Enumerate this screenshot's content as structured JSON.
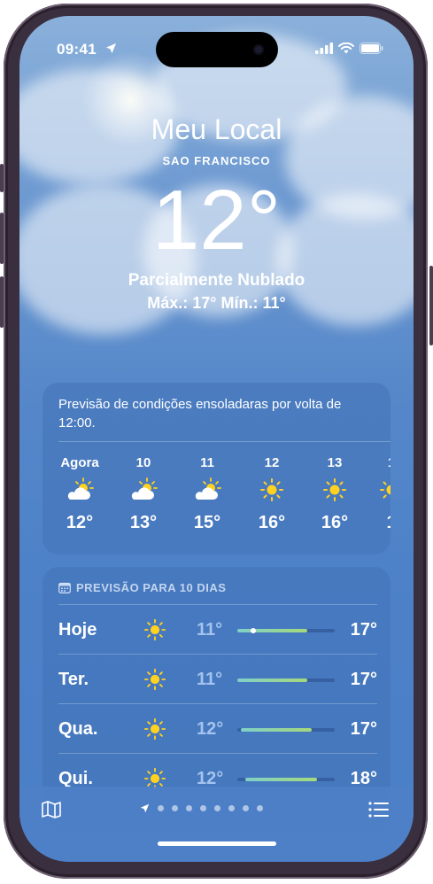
{
  "status": {
    "time": "09:41"
  },
  "header": {
    "location_name": "Meu Local",
    "city": "SAO FRANCISCO",
    "temperature": "12°",
    "condition": "Parcialmente Nublado",
    "high_low": "Máx.: 17° Mín.: 11°"
  },
  "hourly": {
    "summary": "Previsão de condições ensoladaras por volta de 12:00.",
    "items": [
      {
        "label": "Agora",
        "icon": "partly-cloudy-icon",
        "temp": "12°"
      },
      {
        "label": "10",
        "icon": "partly-cloudy-icon",
        "temp": "13°"
      },
      {
        "label": "11",
        "icon": "partly-cloudy-icon",
        "temp": "15°"
      },
      {
        "label": "12",
        "icon": "sun-icon",
        "temp": "16°"
      },
      {
        "label": "13",
        "icon": "sun-icon",
        "temp": "16°"
      },
      {
        "label": "1",
        "icon": "sun-icon",
        "temp": "1"
      }
    ]
  },
  "daily": {
    "header": "PREVISÃO PARA 10 DIAS",
    "days": [
      {
        "day": "Hoje",
        "icon": "sun-icon",
        "low": "11°",
        "high": "17°",
        "bar_start": 0.0,
        "bar_end": 0.72,
        "current_marker": 0.16
      },
      {
        "day": "Ter.",
        "icon": "sun-icon",
        "low": "11°",
        "high": "17°",
        "bar_start": 0.0,
        "bar_end": 0.72
      },
      {
        "day": "Qua.",
        "icon": "sun-icon",
        "low": "12°",
        "high": "17°",
        "bar_start": 0.04,
        "bar_end": 0.76
      },
      {
        "day": "Qui.",
        "icon": "sun-icon",
        "low": "12°",
        "high": "18°",
        "bar_start": 0.08,
        "bar_end": 0.82
      }
    ]
  },
  "colors": {
    "sun": "#ffd21f",
    "sky": "#4c81c8",
    "range_start": "#7fd0c8",
    "range_end": "#a6d97a"
  },
  "toolbar": {
    "page_count": 9,
    "active_page": 0
  }
}
